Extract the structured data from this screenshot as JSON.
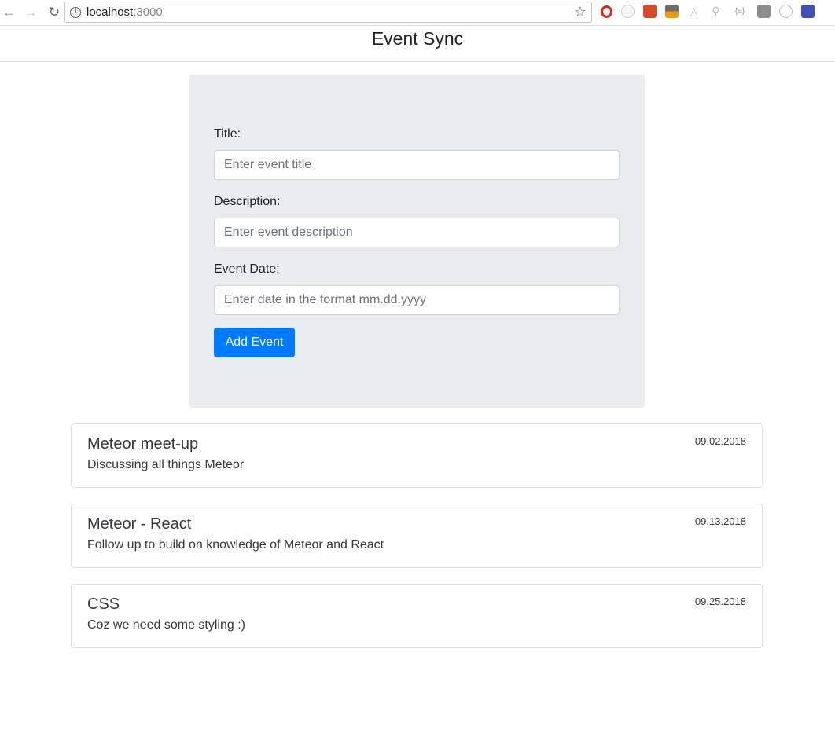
{
  "browser": {
    "url_host": "localhost",
    "url_port": ":3000"
  },
  "header": {
    "title": "Event Sync"
  },
  "form": {
    "title_label": "Title:",
    "title_placeholder": "Enter event title",
    "description_label": "Description:",
    "description_placeholder": "Enter event description",
    "date_label": "Event Date:",
    "date_placeholder": "Enter date in the format mm.dd.yyyy",
    "submit_label": "Add Event"
  },
  "events": [
    {
      "title": "Meteor meet-up",
      "description": "Discussing all things Meteor",
      "date": "09.02.2018"
    },
    {
      "title": "Meteor - React",
      "description": "Follow up to build on knowledge of Meteor and React",
      "date": "09.13.2018"
    },
    {
      "title": "CSS",
      "description": "Coz we need some styling :)",
      "date": "09.25.2018"
    }
  ],
  "colors": {
    "primary": "#007bff",
    "form_background": "#e9ecef"
  },
  "icons": [
    "back-icon",
    "forward-icon",
    "reload-icon",
    "info-icon",
    "star-icon"
  ]
}
